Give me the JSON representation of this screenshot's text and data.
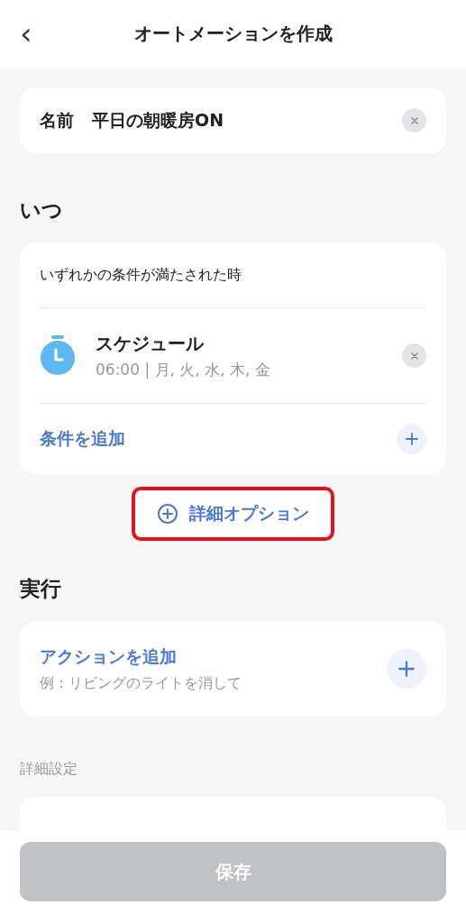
{
  "header": {
    "back": "‹",
    "title": "オートメーションを作成"
  },
  "name_field": {
    "label": "名前",
    "value": "平日の朝暖房ON"
  },
  "when": {
    "heading": "いつ",
    "mode": "いずれかの条件が満たされた時",
    "conditions": [
      {
        "kind": "schedule",
        "title": "スケジュール",
        "detail": "06:00 | 月, 火, 水, 木, 金"
      }
    ],
    "add_label": "条件を追加"
  },
  "advanced_option": {
    "label": "詳細オプション",
    "highlighted": true
  },
  "execute": {
    "heading": "実行",
    "add_label": "アクションを追加",
    "hint": "例：リビングのライトを消して"
  },
  "advanced_settings": {
    "heading": "詳細設定"
  },
  "footer": {
    "save_label": "保存",
    "disabled": true
  }
}
